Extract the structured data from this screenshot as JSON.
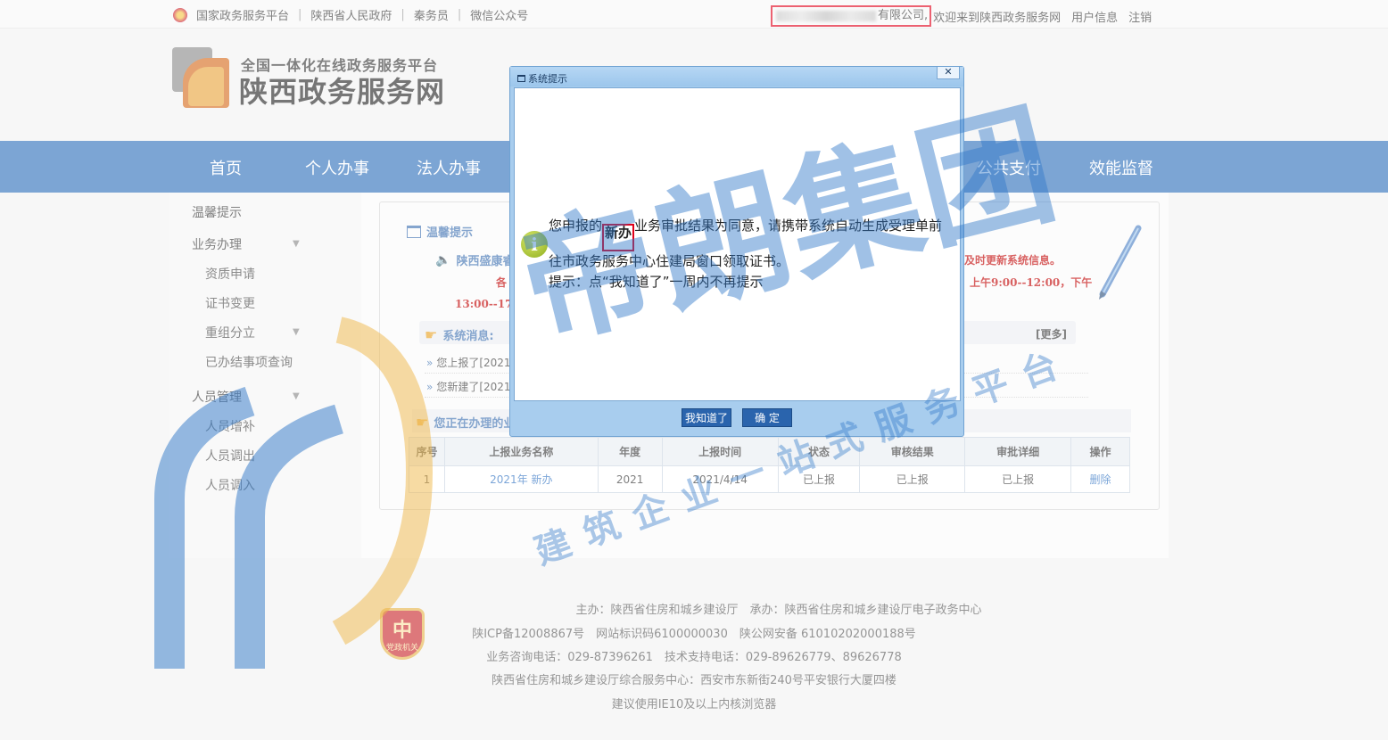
{
  "topbar": {
    "links": [
      "国家政务服务平台",
      "陕西省人民政府",
      "秦务员",
      "微信公众号"
    ],
    "company_suffix": "有限公司,",
    "welcome": "欢迎来到陕西政务服务网",
    "user_info": "用户信息",
    "logout": "注销"
  },
  "header": {
    "subtitle": "全国一体化在线政务服务平台",
    "title": "陕西政务服务网"
  },
  "nav": [
    "首页",
    "个人办事",
    "法人办事",
    "公共支付",
    "效能监督"
  ],
  "sidebar": {
    "items": [
      {
        "label": "温馨提示"
      },
      {
        "label": "业务办理"
      },
      {
        "label": "资质申请"
      },
      {
        "label": "证书变更"
      },
      {
        "label": "重组分立"
      },
      {
        "label": "已办结事项查询"
      },
      {
        "label": "人员管理"
      },
      {
        "label": "人员增补"
      },
      {
        "label": "人员调出"
      },
      {
        "label": "人员调入"
      }
    ]
  },
  "panel": {
    "title": "温馨提示",
    "notice": "陕西盛康睿",
    "red_right": "及时更新系统信息。",
    "red_left": "各",
    "hours_right": "上午9:00--12:00，下午",
    "hours_left": "13:00--17:0",
    "sys_label": "系统消息:",
    "more": "[更多]",
    "sys_lines": [
      "您上报了[2021",
      "您新建了[2021"
    ],
    "proc_label": "您正在办理的业"
  },
  "table": {
    "headers": [
      "序号",
      "上报业务名称",
      "年度",
      "上报时间",
      "状态",
      "审核结果",
      "审批详细",
      "操作"
    ],
    "rows": [
      [
        "1",
        "2021年 新办",
        "2021",
        "2021/4/14",
        "已上报",
        "已上报",
        "已上报",
        "删除"
      ]
    ]
  },
  "footer": {
    "emblem_text": "党政机关",
    "lines": [
      "主办：陕西省住房和城乡建设厅　承办：陕西省住房和城乡建设厅电子政务中心",
      "陕ICP备12008867号　网站标识码6100000030　陕公网安备 61010202000188号",
      "业务咨询电话：029-87396261　技术支持电话：029-89626779、89626778",
      "陕西省住房和城乡建设厅综合服务中心：西安市东新街240号平安银行大厦四楼",
      "建议使用IE10及以上内核浏览器"
    ]
  },
  "dialog": {
    "title": "系统提示",
    "close": "✕",
    "msg_prefix": "您申报的",
    "msg_highlight": "新办",
    "msg_line1": "业务审批结果为同意，请携带系统自动生成受理单前",
    "msg_line2": "往市政务服务中心住建局窗口领取证书。",
    "msg_line3": "提示：点“我知道了”一周内不再提示",
    "btn_know": "我知道了",
    "btn_ok": "确 定"
  },
  "watermark": {
    "main": "帝朗集团",
    "sub": "建筑企业一站式服务平台"
  },
  "colors": {
    "nav_bg": "#2d6fba",
    "highlight_red": "#e0001a",
    "watermark_blue": "#2f78c9"
  }
}
